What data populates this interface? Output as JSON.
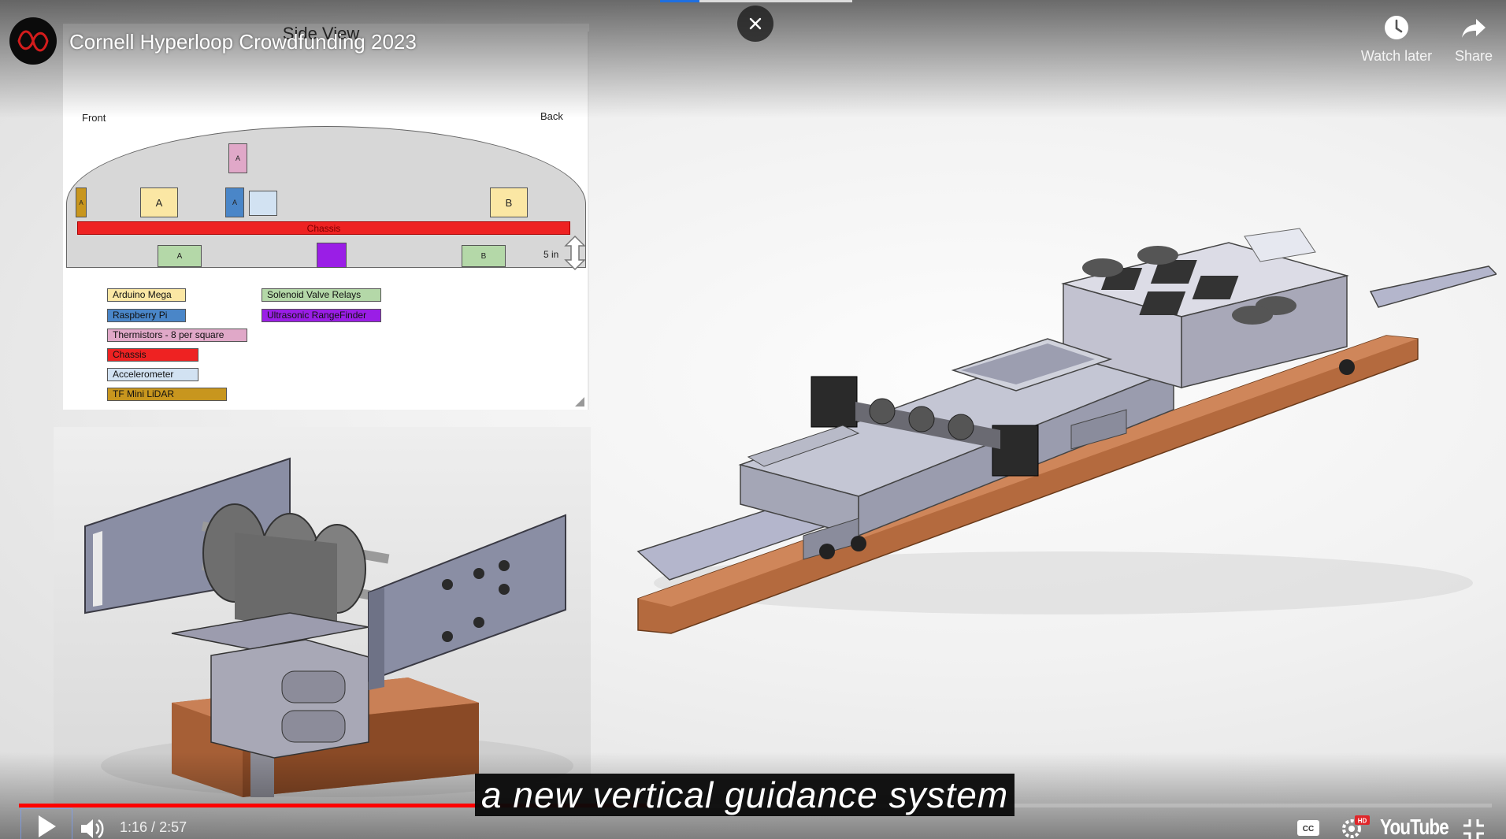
{
  "header": {
    "title": "Cornell Hyperloop Crowdfunding 2023",
    "watch_later_label": "Watch later",
    "share_label": "Share"
  },
  "diagram": {
    "title": "Side View",
    "front_label": "Front",
    "back_label": "Back",
    "chassis_label": "Chassis",
    "dimension_label": "5 in",
    "blocks": {
      "thermistor_top": "A",
      "lidar_left": "A",
      "arduino_a": "A",
      "pi_a": "A",
      "arduino_b": "B",
      "relay_a": "A",
      "relay_b": "B"
    },
    "legend": [
      {
        "label": "Arduino Mega",
        "color": "#fbe7a4"
      },
      {
        "label": "Raspberry Pi",
        "color": "#4a86c8"
      },
      {
        "label": "Thermistors - 8 per square",
        "color": "#e0a8c8"
      },
      {
        "label": "Chassis",
        "color": "#ee2222"
      },
      {
        "label": "Accelerometer",
        "color": "#d2e2f2"
      },
      {
        "label": "TF Mini LiDAR",
        "color": "#c8961e"
      },
      {
        "label": "Solenoid Valve Relays",
        "color": "#b4d8a8"
      },
      {
        "label": "Ultrasonic RangeFinder",
        "color": "#9a1ee6"
      }
    ]
  },
  "caption": {
    "text": "a new vertical guidance system"
  },
  "controls": {
    "current_time": "1:16",
    "separator": " / ",
    "duration": "2:57",
    "played_fraction": 0.429,
    "loaded_fraction": 0.47,
    "youtube_label": "YouTube",
    "hd_badge": "HD"
  },
  "colors": {
    "progress_played": "#ff0000",
    "accent_blue": "#1f6fe0"
  }
}
